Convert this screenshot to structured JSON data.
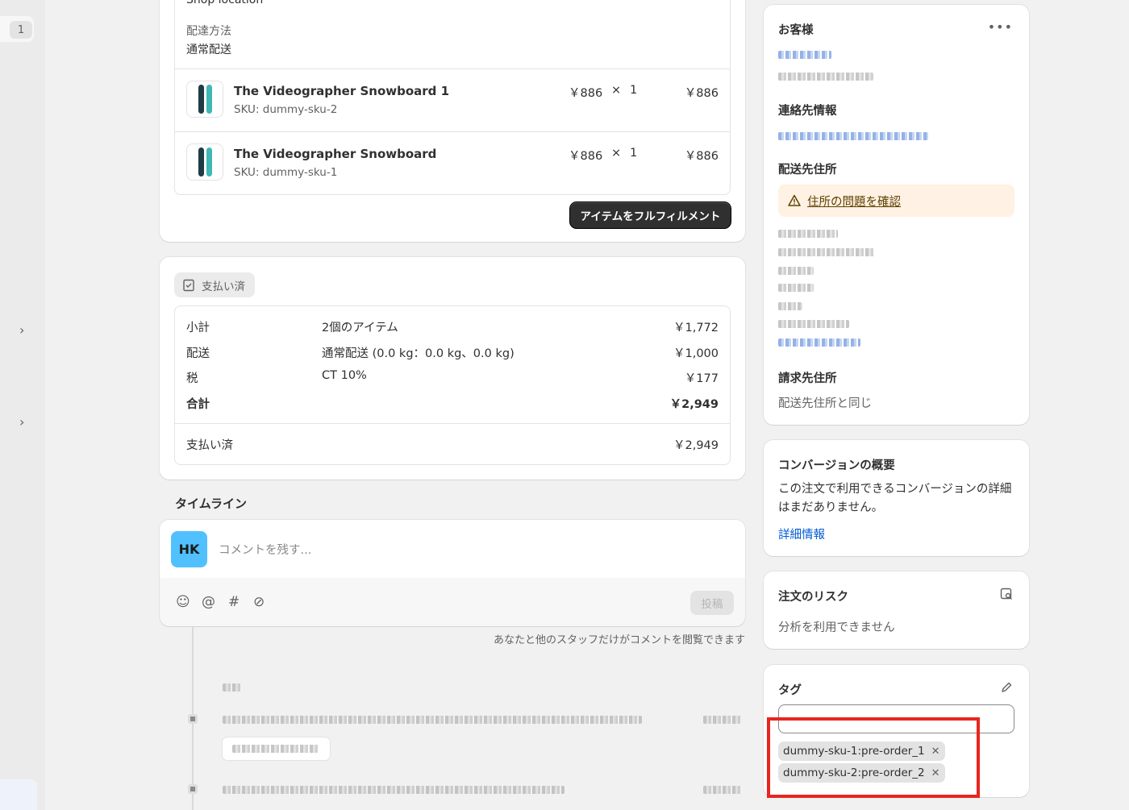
{
  "sidebar": {
    "badge": "1",
    "chevron": "›"
  },
  "fulfillment": {
    "shop_location": "Shop location",
    "method_label": "配達方法",
    "method_value": "通常配送",
    "items": [
      {
        "title": "The Videographer Snowboard 1",
        "sku": "SKU: dummy-sku-2",
        "price": "￥886",
        "times": "×",
        "qty": "1",
        "total": "￥886"
      },
      {
        "title": "The Videographer Snowboard",
        "sku": "SKU: dummy-sku-1",
        "price": "￥886",
        "times": "×",
        "qty": "1",
        "total": "￥886"
      }
    ],
    "fulfill_button": "アイテムをフルフィルメント"
  },
  "payment": {
    "badge": "支払い済",
    "rows": [
      {
        "label": "小計",
        "desc": "2個のアイテム",
        "amount": "￥1,772"
      },
      {
        "label": "配送",
        "desc": "通常配送 (0.0 kg：0.0 kg、0.0 kg)",
        "amount": "￥1,000"
      },
      {
        "label": "税",
        "desc": "CT 10%",
        "amount": "￥177"
      },
      {
        "label": "合計",
        "desc": "",
        "amount": "￥2,949"
      }
    ],
    "paid_label": "支払い済",
    "paid_amount": "￥2,949"
  },
  "timeline": {
    "title": "タイムライン",
    "avatar_initials": "HK",
    "comment_placeholder": "コメントを残す...",
    "post_button": "投稿",
    "staff_note": "あなたと他のスタッフだけがコメントを閲覧できます"
  },
  "customer": {
    "title": "お客様",
    "more": "•••",
    "contact_title": "連絡先情報",
    "shipping_title": "配送先住所",
    "address_warning": "住所の問題を確認",
    "billing_title": "請求先住所",
    "billing_value": "配送先住所と同じ"
  },
  "conversion": {
    "title": "コンバージョンの概要",
    "desc": "この注文で利用できるコンバージョンの詳細はまだありません。",
    "link": "詳細情報"
  },
  "risk": {
    "title": "注文のリスク",
    "desc": "分析を利用できません"
  },
  "tags": {
    "title": "タグ",
    "items": [
      "dummy-sku-1:pre-order_1",
      "dummy-sku-2:pre-order_2"
    ]
  },
  "colors": {
    "highlight": "#e8251f",
    "link": "#005bd3",
    "avatar": "#51c0ff",
    "warning_bg": "#fff1e3"
  }
}
